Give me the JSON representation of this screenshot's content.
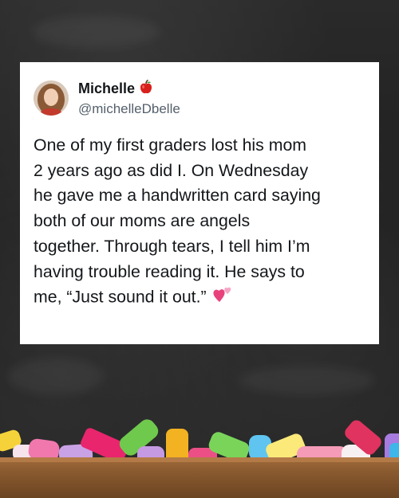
{
  "tweet": {
    "display_name": "Michelle",
    "handle": "@michelleDbelle",
    "text": "One of my first graders lost his mom\n2 years ago as did I. On Wednesday\nhe gave me a handwritten card saying\nboth of our moms are angels\ntogether. Through tears, I tell him I’m\nhaving trouble reading it. He says to\nme, “Just sound it out.”"
  },
  "icons": {
    "badge": "red-apple-icon",
    "emoji": "two-hearts-icon",
    "avatar": "avatar"
  },
  "colors": {
    "chalkboard": "#222222",
    "card": "#ffffff",
    "text": "#14171a",
    "handle": "#55606b",
    "ledge": "#8a5a2f"
  }
}
